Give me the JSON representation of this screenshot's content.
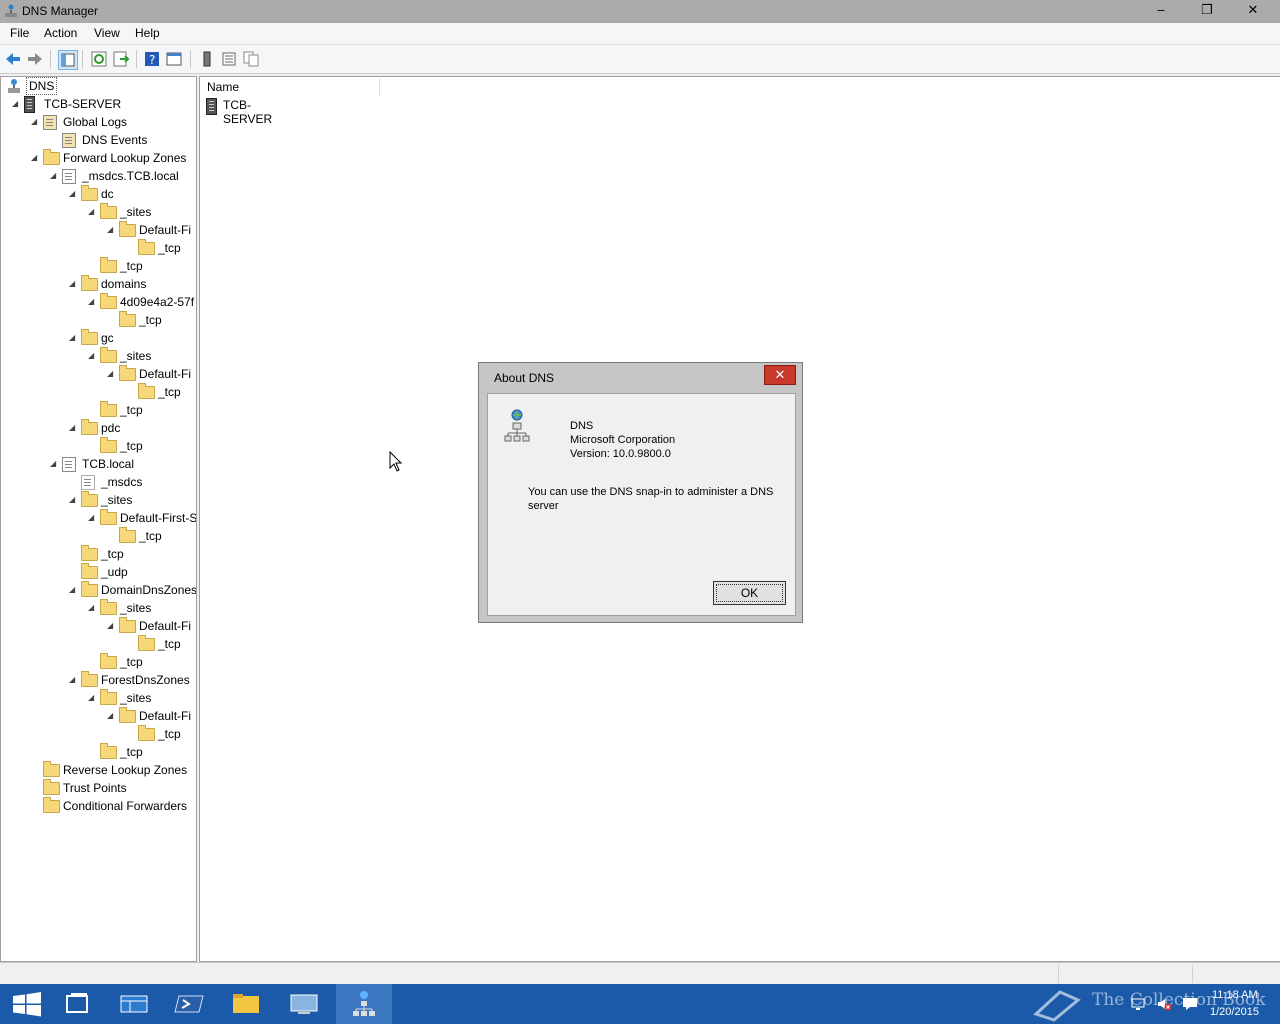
{
  "window": {
    "title": "DNS Manager",
    "minimize": "–",
    "restore": "❐",
    "close": "✕"
  },
  "menu": [
    "File",
    "Action",
    "View",
    "Help"
  ],
  "tree": {
    "root": "DNS",
    "items": [
      {
        "label": "TCB-SERVER"
      },
      {
        "label": "Global Logs"
      },
      {
        "label": "DNS Events"
      },
      {
        "label": "Forward Lookup Zones"
      },
      {
        "label": "_msdcs.TCB.local"
      },
      {
        "label": "dc"
      },
      {
        "label": "_sites"
      },
      {
        "label": "Default-Fi"
      },
      {
        "label": "_tcp"
      },
      {
        "label": "_tcp"
      },
      {
        "label": "domains"
      },
      {
        "label": "4d09e4a2-57f"
      },
      {
        "label": "_tcp"
      },
      {
        "label": "gc"
      },
      {
        "label": "_sites"
      },
      {
        "label": "Default-Fi"
      },
      {
        "label": "_tcp"
      },
      {
        "label": "_tcp"
      },
      {
        "label": "pdc"
      },
      {
        "label": "_tcp"
      },
      {
        "label": "TCB.local"
      },
      {
        "label": "_msdcs"
      },
      {
        "label": "_sites"
      },
      {
        "label": "Default-First-S"
      },
      {
        "label": "_tcp"
      },
      {
        "label": "_tcp"
      },
      {
        "label": "_udp"
      },
      {
        "label": "DomainDnsZones"
      },
      {
        "label": "_sites"
      },
      {
        "label": "Default-Fi"
      },
      {
        "label": "_tcp"
      },
      {
        "label": "_tcp"
      },
      {
        "label": "ForestDnsZones"
      },
      {
        "label": "_sites"
      },
      {
        "label": "Default-Fi"
      },
      {
        "label": "_tcp"
      },
      {
        "label": "_tcp"
      },
      {
        "label": "Reverse Lookup Zones"
      },
      {
        "label": "Trust Points"
      },
      {
        "label": "Conditional Forwarders"
      }
    ]
  },
  "list": {
    "column": "Name",
    "rows": [
      "TCB-SERVER"
    ]
  },
  "dialog": {
    "title": "About DNS",
    "close": "✕",
    "product": "DNS",
    "company": "Microsoft Corporation",
    "version": "Version: 10.0.9800.0",
    "description": "You can use the DNS snap-in to administer a DNS server",
    "ok": "OK"
  },
  "taskbar": {
    "time": "11:18 AM",
    "date": "1/20/2015",
    "watermark": "The Collection Book"
  }
}
